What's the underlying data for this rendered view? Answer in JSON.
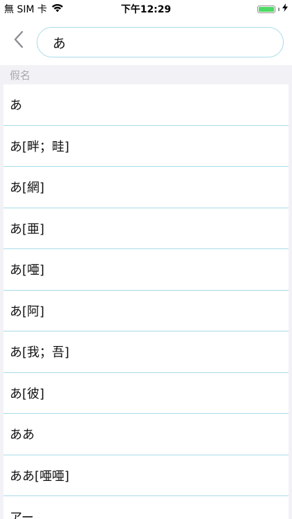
{
  "status_bar": {
    "carrier": "無 SIM 卡",
    "time": "下午12:29",
    "battery_level": 1.0,
    "colors": {
      "battery": "#4cd964"
    }
  },
  "nav": {
    "back_icon": "chevron-left-icon",
    "search_value": "あ",
    "accent_border": "#a7dbe8"
  },
  "section": {
    "title": "假名"
  },
  "results": [
    {
      "text": "あ"
    },
    {
      "text": "あ[畔；畦]"
    },
    {
      "text": "あ[網]"
    },
    {
      "text": "あ[亜]"
    },
    {
      "text": "あ[唖]"
    },
    {
      "text": "あ[阿]"
    },
    {
      "text": "あ[我；吾]"
    },
    {
      "text": "あ[彼]"
    },
    {
      "text": "ああ"
    },
    {
      "text": "ああ[唖唖]"
    },
    {
      "text": "アー"
    }
  ]
}
